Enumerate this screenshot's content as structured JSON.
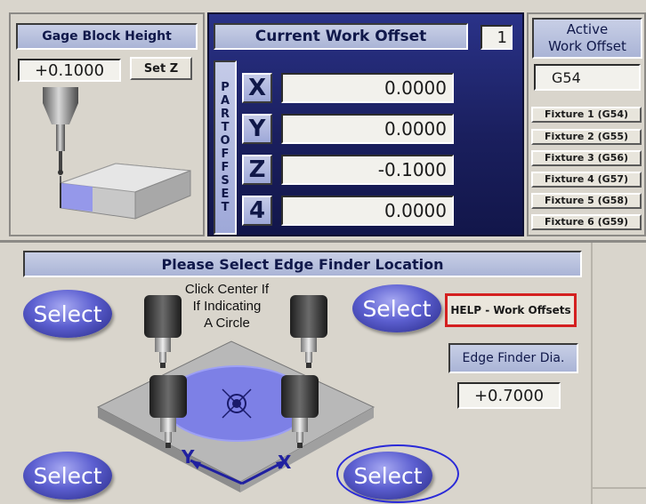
{
  "gage": {
    "title": "Gage Block Height",
    "value": "+0.1000",
    "set_z_label": "Set Z"
  },
  "work_offset": {
    "title": "Current Work Offset",
    "number": "1",
    "part_offset_letters": [
      "P",
      "A",
      "R",
      "T",
      " ",
      "O",
      "F",
      "F",
      "S",
      "E",
      "T"
    ],
    "axes": [
      {
        "label": "X",
        "value": "0.0000"
      },
      {
        "label": "Y",
        "value": "0.0000"
      },
      {
        "label": "Z",
        "value": "-0.1000"
      },
      {
        "label": "4",
        "value": "0.0000"
      }
    ]
  },
  "active": {
    "title_line1": "Active",
    "title_line2": "Work Offset",
    "value": "G54",
    "fixtures": [
      "Fixture 1 (G54)",
      "Fixture 2 (G55)",
      "Fixture 3 (G56)",
      "Fixture 4 (G57)",
      "Fixture 5 (G58)",
      "Fixture 6 (G59)"
    ]
  },
  "edge_finder": {
    "title": "Please Select Edge Finder Location",
    "select_label": "Select",
    "center_hint_line1": "Click Center If",
    "center_hint_line2": "If Indicating",
    "center_hint_line3": "A Circle",
    "help_label": "HELP - Work Offsets",
    "dia_label": "Edge Finder Dia.",
    "dia_value": "+0.7000",
    "axis_y": "Y",
    "axis_x": "X"
  },
  "colors": {
    "background": "#d9d5cc",
    "title_bar": "#aab4d6",
    "select_button": "#4e51c7",
    "help_border": "#d42020",
    "highlight_ring": "#2a2ad8"
  }
}
